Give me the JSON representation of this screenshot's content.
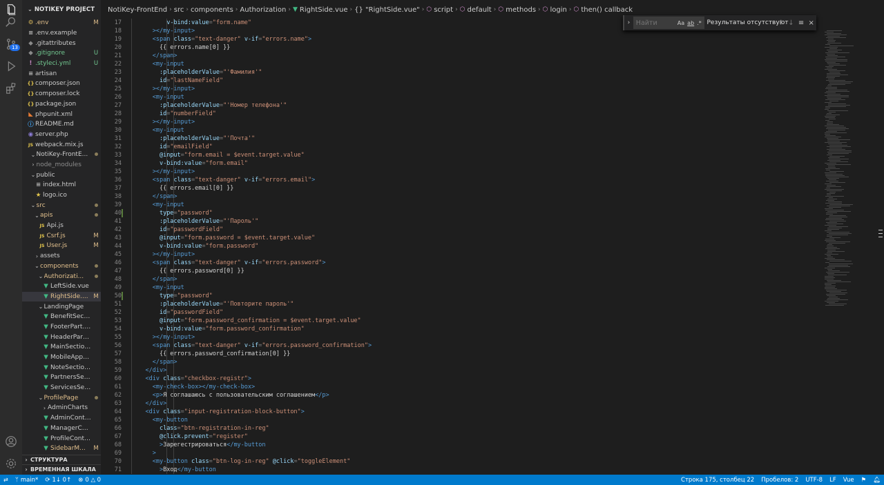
{
  "explorer": {
    "title": "NOTIKEY PROJECT",
    "items": [
      {
        "name": ".env",
        "indent": 0,
        "icon": "gear",
        "status": "M"
      },
      {
        "name": ".env.example",
        "indent": 0,
        "icon": "lines",
        "status": ""
      },
      {
        "name": ".gitattributes",
        "indent": 0,
        "icon": "diamond",
        "status": ""
      },
      {
        "name": ".gitignore",
        "indent": 0,
        "icon": "diamond",
        "status": "U"
      },
      {
        "name": ".styleci.yml",
        "indent": 0,
        "icon": "exclamation",
        "status": "U"
      },
      {
        "name": "artisan",
        "indent": 0,
        "icon": "lines",
        "status": ""
      },
      {
        "name": "composer.json",
        "indent": 0,
        "icon": "braces",
        "status": ""
      },
      {
        "name": "composer.lock",
        "indent": 0,
        "icon": "braces",
        "status": ""
      },
      {
        "name": "package.json",
        "indent": 0,
        "icon": "braces",
        "status": ""
      },
      {
        "name": "phpunit.xml",
        "indent": 0,
        "icon": "rss",
        "status": ""
      },
      {
        "name": "README.md",
        "indent": 0,
        "icon": "info",
        "status": ""
      },
      {
        "name": "server.php",
        "indent": 0,
        "icon": "php",
        "status": ""
      },
      {
        "name": "webpack.mix.js",
        "indent": 0,
        "icon": "js",
        "status": ""
      },
      {
        "name": "NotiKey-FrontE...",
        "indent": 1,
        "icon": "chevron-down",
        "status": "dot",
        "folder": true
      },
      {
        "name": "node_modules",
        "indent": 1,
        "icon": "chevron-right",
        "status": "",
        "folder": true,
        "dim": true
      },
      {
        "name": "public",
        "indent": 1,
        "icon": "chevron-down",
        "status": "",
        "folder": true
      },
      {
        "name": "index.html",
        "indent": 2,
        "icon": "lines",
        "status": ""
      },
      {
        "name": "logo.ico",
        "indent": 2,
        "icon": "star",
        "status": ""
      },
      {
        "name": "src",
        "indent": 1,
        "icon": "chevron-down",
        "status": "dot",
        "folder": true,
        "mod": true
      },
      {
        "name": "apis",
        "indent": 2,
        "icon": "chevron-down",
        "status": "dot",
        "folder": true,
        "mod": true
      },
      {
        "name": "Api.js",
        "indent": 3,
        "icon": "js",
        "status": ""
      },
      {
        "name": "Csrf.js",
        "indent": 3,
        "icon": "js",
        "status": "M"
      },
      {
        "name": "User.js",
        "indent": 3,
        "icon": "js",
        "status": "M"
      },
      {
        "name": "assets",
        "indent": 2,
        "icon": "chevron-right",
        "status": "",
        "folder": true
      },
      {
        "name": "components",
        "indent": 2,
        "icon": "chevron-down",
        "status": "dot",
        "folder": true,
        "mod": true
      },
      {
        "name": "Authorizati...",
        "indent": 3,
        "icon": "chevron-down",
        "status": "dot",
        "folder": true,
        "mod": true
      },
      {
        "name": "LeftSide.vue",
        "indent": 4,
        "icon": "vue",
        "status": ""
      },
      {
        "name": "RightSide....",
        "indent": 4,
        "icon": "vue",
        "status": "M",
        "selected": true
      },
      {
        "name": "LandingPage",
        "indent": 3,
        "icon": "chevron-down",
        "status": "",
        "folder": true
      },
      {
        "name": "BenefitSection...",
        "indent": 4,
        "icon": "vue",
        "status": ""
      },
      {
        "name": "FooterPart.vue",
        "indent": 4,
        "icon": "vue",
        "status": ""
      },
      {
        "name": "HeaderPart.vue",
        "indent": 4,
        "icon": "vue",
        "status": ""
      },
      {
        "name": "MainSection.vue",
        "indent": 4,
        "icon": "vue",
        "status": ""
      },
      {
        "name": "MobileAppSect...",
        "indent": 4,
        "icon": "vue",
        "status": ""
      },
      {
        "name": "NoteSection.vue",
        "indent": 4,
        "icon": "vue",
        "status": ""
      },
      {
        "name": "PartnersSectio...",
        "indent": 4,
        "icon": "vue",
        "status": ""
      },
      {
        "name": "ServicesSectio...",
        "indent": 4,
        "icon": "vue",
        "status": ""
      },
      {
        "name": "ProfilePage",
        "indent": 3,
        "icon": "chevron-down",
        "status": "dot",
        "folder": true,
        "mod": true
      },
      {
        "name": "AdminCharts",
        "indent": 4,
        "icon": "chevron-right",
        "status": "",
        "folder": true
      },
      {
        "name": "AdminContent....",
        "indent": 4,
        "icon": "vue",
        "status": ""
      },
      {
        "name": "ManagerConte...",
        "indent": 4,
        "icon": "vue",
        "status": ""
      },
      {
        "name": "ProfileConten...",
        "indent": 4,
        "icon": "vue",
        "status": ""
      },
      {
        "name": "SidebarM...",
        "indent": 4,
        "icon": "vue",
        "status": "M",
        "mod": true
      }
    ],
    "structure_label": "СТРУКТУРА",
    "timeline_label": "ВРЕМЕННАЯ ШКАЛА"
  },
  "activity_bar": {
    "source_control_badge": "13",
    "icons": [
      "files-icon",
      "search-icon",
      "source-control-icon",
      "run-debug-icon",
      "extensions-icon",
      "account-icon",
      "settings-gear-icon"
    ]
  },
  "breadcrumbs": [
    "NotiKey-FrontEnd",
    "src",
    "components",
    "Authorization",
    "RightSide.vue",
    "{} \"RightSide.vue\"",
    "script",
    "default",
    "methods",
    "login",
    "then() callback"
  ],
  "find_widget": {
    "placeholder": "Найти",
    "options": [
      "Aa",
      "ab",
      ".*"
    ],
    "result": "Результаты отсутствуют"
  },
  "editor": {
    "first_line": 17,
    "modified_lines": [
      40,
      50
    ],
    "lines": [
      [
        [
          "",
          "        "
        ],
        [
          "pu",
          "  "
        ],
        [
          "at",
          "v-bind:value"
        ],
        [
          "pu",
          "="
        ],
        [
          "sv",
          "\"form.name\""
        ]
      ],
      [
        [
          "",
          "      "
        ],
        [
          "tg",
          "></my-input>"
        ]
      ],
      [
        [
          "",
          "      "
        ],
        [
          "tg",
          "<span "
        ],
        [
          "at",
          "class"
        ],
        [
          "pu",
          "="
        ],
        [
          "sv",
          "\"text-danger\""
        ],
        [
          "",
          " "
        ],
        [
          "at",
          "v-if"
        ],
        [
          "pu",
          "="
        ],
        [
          "sv",
          "\"errors.name\""
        ],
        [
          "tg",
          ">"
        ]
      ],
      [
        [
          "",
          "        "
        ],
        [
          "",
          "{{ errors.name[0] }}"
        ]
      ],
      [
        [
          "",
          "      "
        ],
        [
          "tg",
          "</span>"
        ]
      ],
      [
        [
          "",
          "      "
        ],
        [
          "tg",
          "<my-input"
        ]
      ],
      [
        [
          "",
          "        "
        ],
        [
          "at",
          ":placeholderValue"
        ],
        [
          "pu",
          "="
        ],
        [
          "sv",
          "\"'Фамилия'\""
        ]
      ],
      [
        [
          "",
          "        "
        ],
        [
          "at",
          "id"
        ],
        [
          "pu",
          "="
        ],
        [
          "sv",
          "\"lastNameField\""
        ]
      ],
      [
        [
          "",
          "      "
        ],
        [
          "tg",
          "></my-input>"
        ]
      ],
      [
        [
          "",
          "      "
        ],
        [
          "tg",
          "<my-input"
        ]
      ],
      [
        [
          "",
          "        "
        ],
        [
          "at",
          ":placeholderValue"
        ],
        [
          "pu",
          "="
        ],
        [
          "sv",
          "\"'Номер телефона'\""
        ]
      ],
      [
        [
          "",
          "        "
        ],
        [
          "at",
          "id"
        ],
        [
          "pu",
          "="
        ],
        [
          "sv",
          "\"numberField\""
        ]
      ],
      [
        [
          "",
          "      "
        ],
        [
          "tg",
          "></my-input>"
        ]
      ],
      [
        [
          "",
          "      "
        ],
        [
          "tg",
          "<my-input"
        ]
      ],
      [
        [
          "",
          "        "
        ],
        [
          "at",
          ":placeholderValue"
        ],
        [
          "pu",
          "="
        ],
        [
          "sv",
          "\"'Почта'\""
        ]
      ],
      [
        [
          "",
          "        "
        ],
        [
          "at",
          "id"
        ],
        [
          "pu",
          "="
        ],
        [
          "sv",
          "\"emailField\""
        ]
      ],
      [
        [
          "",
          "        "
        ],
        [
          "at",
          "@input"
        ],
        [
          "pu",
          "="
        ],
        [
          "sv",
          "\"form.email = $event.target.value\""
        ]
      ],
      [
        [
          "",
          "        "
        ],
        [
          "at",
          "v-bind:value"
        ],
        [
          "pu",
          "="
        ],
        [
          "sv",
          "\"form.email\""
        ]
      ],
      [
        [
          "",
          "      "
        ],
        [
          "tg",
          "></my-input>"
        ]
      ],
      [
        [
          "",
          "      "
        ],
        [
          "tg",
          "<span "
        ],
        [
          "at",
          "class"
        ],
        [
          "pu",
          "="
        ],
        [
          "sv",
          "\"text-danger\""
        ],
        [
          "",
          " "
        ],
        [
          "at",
          "v-if"
        ],
        [
          "pu",
          "="
        ],
        [
          "sv",
          "\"errors.email\""
        ],
        [
          "tg",
          ">"
        ]
      ],
      [
        [
          "",
          "        "
        ],
        [
          "",
          "{{ errors.email[0] }}"
        ]
      ],
      [
        [
          "",
          "      "
        ],
        [
          "tg",
          "</span>"
        ]
      ],
      [
        [
          "",
          "      "
        ],
        [
          "tg",
          "<my-input"
        ]
      ],
      [
        [
          "",
          "        "
        ],
        [
          "at",
          "type"
        ],
        [
          "pu",
          "="
        ],
        [
          "sv",
          "\"password\""
        ]
      ],
      [
        [
          "",
          "        "
        ],
        [
          "at",
          ":placeholderValue"
        ],
        [
          "pu",
          "="
        ],
        [
          "sv",
          "\"'Пароль'\""
        ]
      ],
      [
        [
          "",
          "        "
        ],
        [
          "at",
          "id"
        ],
        [
          "pu",
          "="
        ],
        [
          "sv",
          "\"passwordField\""
        ]
      ],
      [
        [
          "",
          "        "
        ],
        [
          "at",
          "@input"
        ],
        [
          "pu",
          "="
        ],
        [
          "sv",
          "\"form.password = $event.target.value\""
        ]
      ],
      [
        [
          "",
          "        "
        ],
        [
          "at",
          "v-bind:value"
        ],
        [
          "pu",
          "="
        ],
        [
          "sv",
          "\"form.password\""
        ]
      ],
      [
        [
          "",
          "      "
        ],
        [
          "tg",
          "></my-input>"
        ]
      ],
      [
        [
          "",
          "      "
        ],
        [
          "tg",
          "<span "
        ],
        [
          "at",
          "class"
        ],
        [
          "pu",
          "="
        ],
        [
          "sv",
          "\"text-danger\""
        ],
        [
          "",
          " "
        ],
        [
          "at",
          "v-if"
        ],
        [
          "pu",
          "="
        ],
        [
          "sv",
          "\"errors.password\""
        ],
        [
          "tg",
          ">"
        ]
      ],
      [
        [
          "",
          "        "
        ],
        [
          "",
          "{{ errors.password[0] }}"
        ]
      ],
      [
        [
          "",
          "      "
        ],
        [
          "tg",
          "</span>"
        ]
      ],
      [
        [
          "",
          "      "
        ],
        [
          "tg",
          "<my-input"
        ]
      ],
      [
        [
          "",
          "        "
        ],
        [
          "at",
          "type"
        ],
        [
          "pu",
          "="
        ],
        [
          "sv",
          "\"password\""
        ]
      ],
      [
        [
          "",
          "        "
        ],
        [
          "at",
          ":placeholderValue"
        ],
        [
          "pu",
          "="
        ],
        [
          "sv",
          "\"'Повторите пароль'\""
        ]
      ],
      [
        [
          "",
          "        "
        ],
        [
          "at",
          "id"
        ],
        [
          "pu",
          "="
        ],
        [
          "sv",
          "\"passwordField\""
        ]
      ],
      [
        [
          "",
          "        "
        ],
        [
          "at",
          "@input"
        ],
        [
          "pu",
          "="
        ],
        [
          "sv",
          "\"form.password_confirmation = $event.target.value\""
        ]
      ],
      [
        [
          "",
          "        "
        ],
        [
          "at",
          "v-bind:value"
        ],
        [
          "pu",
          "="
        ],
        [
          "sv",
          "\"form.password_confirmation\""
        ]
      ],
      [
        [
          "",
          "      "
        ],
        [
          "tg",
          "></my-input>"
        ]
      ],
      [
        [
          "",
          "      "
        ],
        [
          "tg",
          "<span "
        ],
        [
          "at",
          "class"
        ],
        [
          "pu",
          "="
        ],
        [
          "sv",
          "\"text-danger\""
        ],
        [
          "",
          " "
        ],
        [
          "at",
          "v-if"
        ],
        [
          "pu",
          "="
        ],
        [
          "sv",
          "\"errors.password_confirmation\""
        ],
        [
          "tg",
          ">"
        ]
      ],
      [
        [
          "",
          "        "
        ],
        [
          "",
          "{{ errors.password_confirmation[0] }}"
        ]
      ],
      [
        [
          "",
          "      "
        ],
        [
          "tg",
          "</span>"
        ]
      ],
      [
        [
          "",
          "    "
        ],
        [
          "tg",
          "</div>"
        ]
      ],
      [
        [
          "",
          "    "
        ],
        [
          "tg",
          "<div "
        ],
        [
          "at",
          "class"
        ],
        [
          "pu",
          "="
        ],
        [
          "sv",
          "\"checkbox-registr\""
        ],
        [
          "tg",
          ">"
        ]
      ],
      [
        [
          "",
          "      "
        ],
        [
          "tg",
          "<my-check-box></my-check-box>"
        ]
      ],
      [
        [
          "",
          "      "
        ],
        [
          "tg",
          "<p>"
        ],
        [
          "",
          "Я соглашаюсь с пользовательским соглашением"
        ],
        [
          "tg",
          "</p>"
        ]
      ],
      [
        [
          "",
          "    "
        ],
        [
          "tg",
          "</div>"
        ]
      ],
      [
        [
          "",
          "    "
        ],
        [
          "tg",
          "<div "
        ],
        [
          "at",
          "class"
        ],
        [
          "pu",
          "="
        ],
        [
          "sv",
          "\"input-registration-block-button\""
        ],
        [
          "tg",
          ">"
        ]
      ],
      [
        [
          "",
          "      "
        ],
        [
          "tg",
          "<my-button"
        ]
      ],
      [
        [
          "",
          "        "
        ],
        [
          "at",
          "class"
        ],
        [
          "pu",
          "="
        ],
        [
          "sv",
          "\"btn-registration-in-reg\""
        ]
      ],
      [
        [
          "",
          "        "
        ],
        [
          "at",
          "@click.prevent"
        ],
        [
          "pu",
          "="
        ],
        [
          "sv",
          "\"register\""
        ]
      ],
      [
        [
          "",
          "        "
        ],
        [
          "tg",
          ">"
        ],
        [
          "",
          "Зарегестрироваться"
        ],
        [
          "tg",
          "</my-button"
        ]
      ],
      [
        [
          "",
          "      "
        ],
        [
          "tg",
          ">"
        ]
      ],
      [
        [
          "",
          "      "
        ],
        [
          "tg",
          "<my-button "
        ],
        [
          "at",
          "class"
        ],
        [
          "pu",
          "="
        ],
        [
          "sv",
          "\"btn-log-in-reg\""
        ],
        [
          "",
          " "
        ],
        [
          "at",
          "@click"
        ],
        [
          "pu",
          "="
        ],
        [
          "sv",
          "\"toggleElement\""
        ]
      ],
      [
        [
          "",
          "        "
        ],
        [
          "tg",
          ">"
        ],
        [
          "",
          "Вход"
        ],
        [
          "tg",
          "</my-button"
        ]
      ]
    ]
  },
  "status_bar": {
    "branch": "main*",
    "sync": "1↓ 0↑",
    "problems": "0 △ 0",
    "position": "Строка 175, столбец 22",
    "indent": "Пробелов: 2",
    "encoding": "UTF-8",
    "eol": "LF",
    "language": "Vue"
  }
}
